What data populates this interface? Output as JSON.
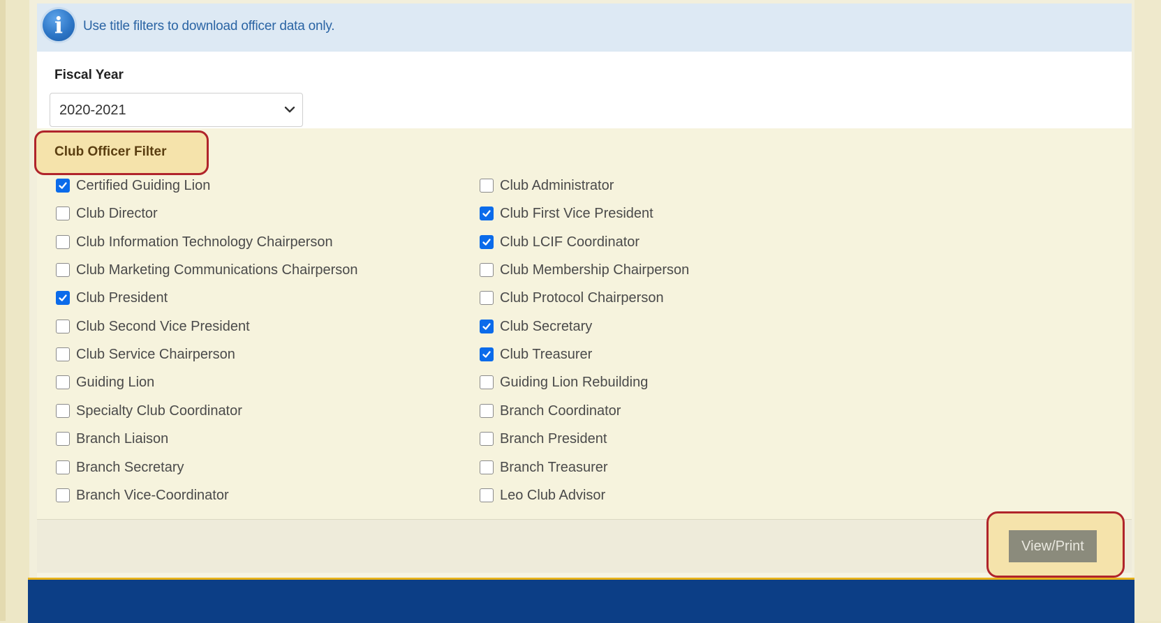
{
  "info": {
    "icon": "info-icon",
    "message": "Use title filters to download officer data only."
  },
  "fiscal_year": {
    "label": "Fiscal Year",
    "selected": "2020-2021"
  },
  "filter": {
    "title": "Club Officer Filter",
    "left": [
      {
        "label": "Certified Guiding Lion",
        "checked": true
      },
      {
        "label": "Club Director",
        "checked": false
      },
      {
        "label": "Club Information Technology Chairperson",
        "checked": false
      },
      {
        "label": "Club Marketing Communications Chairperson",
        "checked": false
      },
      {
        "label": "Club President",
        "checked": true
      },
      {
        "label": "Club Second Vice President",
        "checked": false
      },
      {
        "label": "Club Service Chairperson",
        "checked": false
      },
      {
        "label": "Guiding Lion",
        "checked": false
      },
      {
        "label": "Specialty Club Coordinator",
        "checked": false
      },
      {
        "label": "Branch Liaison",
        "checked": false
      },
      {
        "label": "Branch Secretary",
        "checked": false
      },
      {
        "label": "Branch Vice-Coordinator",
        "checked": false
      }
    ],
    "right": [
      {
        "label": "Club Administrator",
        "checked": false
      },
      {
        "label": "Club First Vice President",
        "checked": true
      },
      {
        "label": "Club LCIF Coordinator",
        "checked": true
      },
      {
        "label": "Club Membership Chairperson",
        "checked": false
      },
      {
        "label": "Club Protocol Chairperson",
        "checked": false
      },
      {
        "label": "Club Secretary",
        "checked": true
      },
      {
        "label": "Club Treasurer",
        "checked": true
      },
      {
        "label": "Guiding Lion Rebuilding",
        "checked": false
      },
      {
        "label": "Branch Coordinator",
        "checked": false
      },
      {
        "label": "Branch President",
        "checked": false
      },
      {
        "label": "Branch Treasurer",
        "checked": false
      },
      {
        "label": "Leo Club Advisor",
        "checked": false
      }
    ]
  },
  "actions": {
    "view_print": "View/Print"
  },
  "colors": {
    "checkbox_checked": "#0b6bea",
    "highlight_border": "#b0242b",
    "highlight_fill": "#f5e3ab",
    "bottom_bar": "#0c3e86"
  }
}
